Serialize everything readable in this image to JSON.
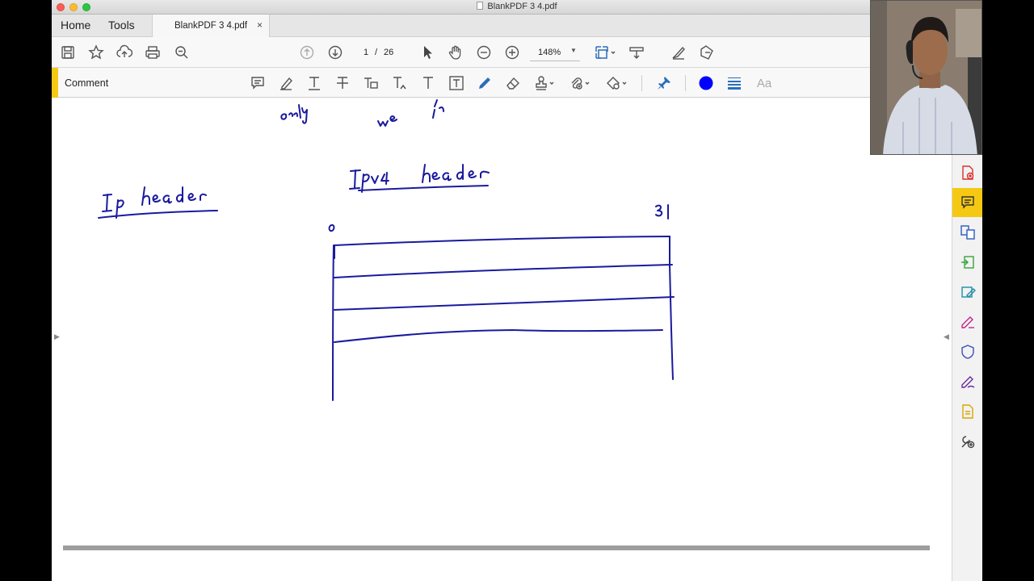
{
  "window": {
    "title": "BlankPDF 3 4.pdf"
  },
  "nav": {
    "home": "Home",
    "tools": "Tools"
  },
  "doc_tab": {
    "label": "BlankPDF 3 4.pdf",
    "close": "×"
  },
  "toolbar": {
    "page_current": "1",
    "page_separator": "/",
    "page_total": "26",
    "zoom": "148%",
    "icons": [
      "save-icon",
      "star-icon",
      "upload-icon",
      "print-icon",
      "find-icon",
      "page-up-icon",
      "page-down-icon",
      "select-cursor-icon",
      "hand-icon",
      "zoom-out-icon",
      "zoom-in-icon",
      "fit-page-icon",
      "scroll-mode-icon",
      "sign-icon",
      "share-icon"
    ]
  },
  "comment_bar": {
    "label": "Comment",
    "font_label": "Aa",
    "accent_color": "#f5c814",
    "icons": [
      "sticky-note-icon",
      "highlight-icon",
      "underline-text-icon",
      "strikethrough-icon",
      "replace-text-icon",
      "insert-text-icon",
      "add-text-icon",
      "text-box-icon",
      "draw-pencil-icon",
      "eraser-icon",
      "stamp-icon",
      "attach-icon",
      "shapes-icon",
      "pin-icon",
      "color-dot-icon",
      "line-weight-icon"
    ],
    "pen_color": "#0000ff"
  },
  "annotations": {
    "ink_color": "#1a1a9e",
    "ip_header": "Ip header",
    "ipv4_header": "IPv4 header",
    "bit_start": "0",
    "bit_end": "31"
  },
  "right_panel": {
    "icons": [
      "create-pdf-icon",
      "comment-icon",
      "organize-pages-icon",
      "export-pdf-icon",
      "edit-pdf-icon",
      "fill-sign-icon",
      "protect-icon",
      "send-for-signature-icon",
      "scan-ocr-icon",
      "more-tools-icon"
    ],
    "active": "comment-icon"
  }
}
